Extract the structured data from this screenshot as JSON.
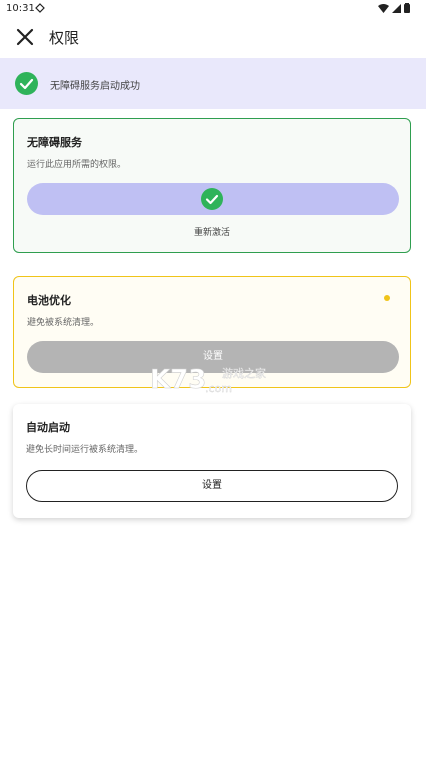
{
  "status_bar": {
    "time": "10:31"
  },
  "app_bar": {
    "title": "权限"
  },
  "banner": {
    "text": "无障碍服务启动成功"
  },
  "accessibility_card": {
    "title": "无障碍服务",
    "description": "运行此应用所需的权限。",
    "reactivate_label": "重新激活"
  },
  "battery_card": {
    "title": "电池优化",
    "description": "避免被系统清理。",
    "button_label": "设置"
  },
  "autostart_card": {
    "title": "自动启动",
    "description": "避免长时间运行被系统清理。",
    "button_label": "设置"
  },
  "watermark": {
    "logo_text": "K73",
    "site_text": "游戏之家",
    "domain_text": ".com"
  },
  "colors": {
    "success": "#2fb35a",
    "accent_pill": "#bfc0f3",
    "banner_bg": "#e9e8fb",
    "warning": "#f0c419"
  },
  "icons": [
    "settings-gear-icon",
    "wifi-icon",
    "signal-icon",
    "battery-icon",
    "close-icon",
    "check-circle-icon"
  ]
}
